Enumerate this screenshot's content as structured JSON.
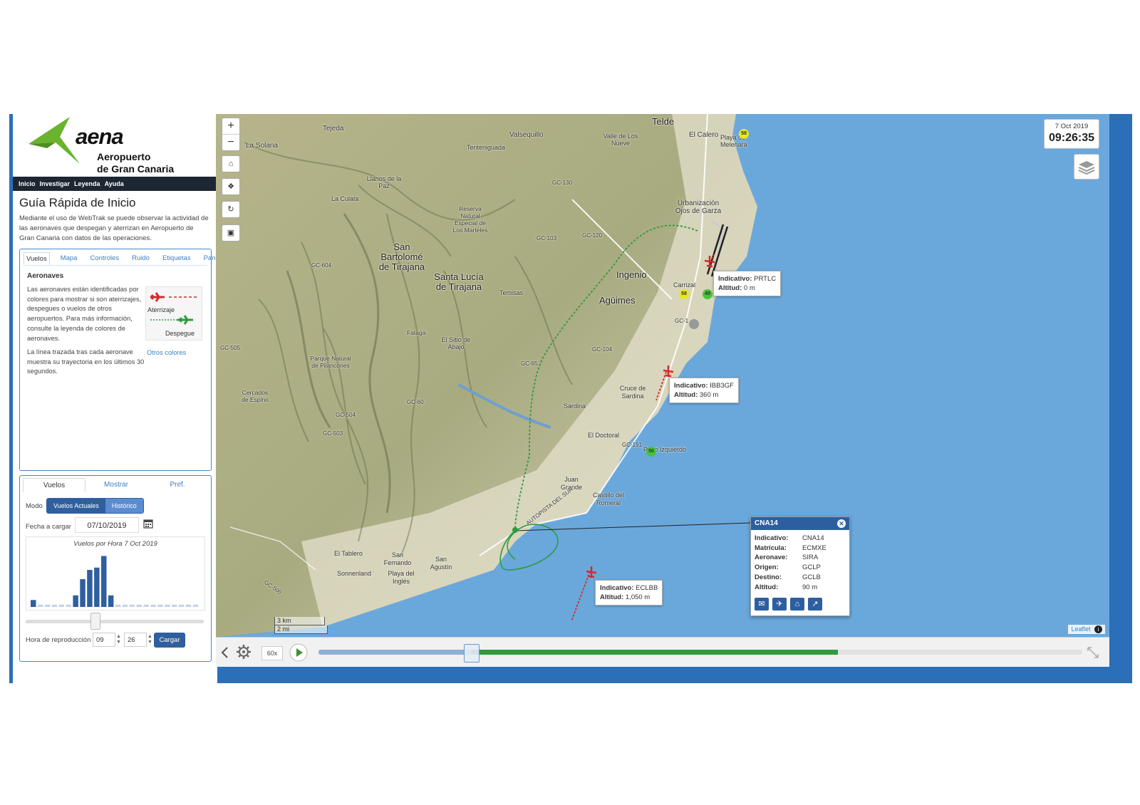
{
  "sidebar": {
    "logo_word": "aena",
    "airport_line1": "Aeropuerto",
    "airport_line2": "de Gran Canaria",
    "nav": [
      "Inicio",
      "Investigar",
      "Leyenda",
      "Ayuda"
    ],
    "guide_title": "Guía Rápida de Inicio",
    "guide_intro": "Mediante el uso de WebTrak se puede observar la actividad de las aeronaves que despegan y aterrizan en Aeropuerto de Gran Canaria con datos de las operaciones.",
    "tabs": [
      "Vuelos",
      "Mapa",
      "Controles",
      "Ruido",
      "Etiquetas",
      "Paneles"
    ],
    "aircraft_title": "Aeronaves",
    "aircraft_text": "Las aeronaves están identificadas por colores para mostrar si son aterrizajes, despegues o vuelos de otros aeropuertos. Para más información, consulte la leyenda de colores de aeronaves.",
    "legend_landing": "Aterrizaje",
    "legend_takeoff": "Despegue",
    "trail_text": "La línea trazada tras cada aeronave muestra su trayectoria en los últimos 30 segundos.",
    "other_colors_link": "Otros colores"
  },
  "controls": {
    "tabs": [
      "Vuelos",
      "Mostrar",
      "Pref."
    ],
    "mode_label": "Modo",
    "mode_options": [
      "Vuelos Actuales",
      "Histórico"
    ],
    "date_label": "Fecha a cargar",
    "date_value": "07/10/2019",
    "histogram": {
      "title": "Vuelos por Hora 7 Oct 2019",
      "values": [
        3,
        1,
        1,
        1,
        1,
        1,
        5,
        12,
        16,
        17,
        22,
        5,
        1,
        1,
        1,
        1,
        1,
        1,
        1,
        1,
        1,
        1,
        1,
        1
      ],
      "max": 24,
      "color": "#2f5f9e",
      "dim_color": "#c8d4e4"
    },
    "playback_label": "Hora de reproducción",
    "hour_value": "09",
    "minute_value": "26",
    "load_button": "Cargar"
  },
  "map": {
    "clock_date": "7 Oct 2019",
    "clock_time": "09:26:35",
    "places": [
      "Telde",
      "Tejeda",
      "Valsequillo",
      "La Solana",
      "El Calero",
      "Playa de Melenara",
      "Valle de Los Nueve",
      "Tenteniguada",
      "Llanos de la Paz",
      "La Culata",
      "San Bartolomé de Tirajana",
      "Santa Lucía de Tirajana",
      "Reserva Natural Especial de Los Marteles",
      "Ingenio",
      "Agüimes",
      "Urbanización Ojos de Garza",
      "Carrizal",
      "Temisas",
      "Cruce de Sardina",
      "Sardina",
      "El Doctoral",
      "Pozo Izquierdo",
      "El Sitio de Abajo",
      "Parque Natural de Pilancones",
      "Cercados de Espino",
      "Juan Grande",
      "Castillo del Romeral",
      "El Tablero",
      "San Fernando",
      "San Agustín",
      "Playa del Inglés",
      "Sonnenland",
      "Fataga",
      "AUTOPISTA DEL SUR"
    ],
    "roads": [
      "GC-130",
      "GC-103",
      "GC-120",
      "GC-604",
      "GC-505",
      "GC-504",
      "GC-503",
      "GC-60",
      "GC-65",
      "GC-104",
      "GC-1",
      "GC-191",
      "GC-500"
    ],
    "noise_badges": [
      "58",
      "58",
      "49",
      "50"
    ],
    "flights": [
      {
        "label_callsign": "Indicativo:",
        "callsign": "PRTLC",
        "label_alt": "Altitud:",
        "altitude": "0 m",
        "color": "#d42a2a"
      },
      {
        "label_callsign": "Indicativo:",
        "callsign": "IBB3GF",
        "label_alt": "Altitud:",
        "altitude": "360 m",
        "color": "#d42a2a"
      },
      {
        "label_callsign": "Indicativo:",
        "callsign": "ECLBB",
        "label_alt": "Altitud:",
        "altitude": "1,050 m",
        "color": "#d42a2a"
      }
    ],
    "popup": {
      "title": "CNA14",
      "rows": [
        {
          "k": "Indicativo:",
          "v": "CNA14"
        },
        {
          "k": "Matrícula:",
          "v": "ECMXE"
        },
        {
          "k": "Aeronave:",
          "v": "SIRA"
        },
        {
          "k": "Origen:",
          "v": "GCLP"
        },
        {
          "k": "Destino:",
          "v": "GCLB"
        },
        {
          "k": "Altitud:",
          "v": "90 m"
        }
      ]
    },
    "scale_km": "3 km",
    "scale_mi": "2 mi",
    "attribution": "Leaflet"
  },
  "playbar": {
    "speed": "60x",
    "progress_played": 0.2,
    "progress_loaded": 0.68
  },
  "colors": {
    "accent": "#2f5f9e",
    "sea": "#6aa8dc",
    "takeoff_track": "#2f9a3d",
    "landing_track": "#d42a2a"
  }
}
